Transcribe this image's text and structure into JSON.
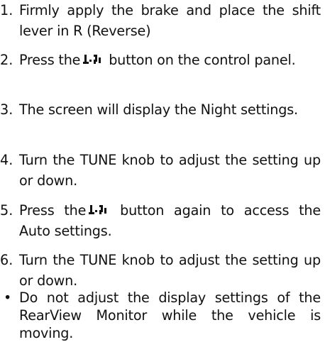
{
  "steps": [
    {
      "num": "1.",
      "text": "Firmly apply the brake and place the shift lever in R (Reverse)"
    },
    {
      "num": "2.",
      "before": "Press the",
      "icon": "camera-display-icon",
      "after": " button on the control panel."
    },
    {
      "num": "3.",
      "text": "The screen will display the Night settings."
    },
    {
      "num": "4.",
      "text": "Turn the TUNE knob to adjust the setting up or down."
    },
    {
      "num": "5.",
      "before": "Press the",
      "icon": "camera-display-icon",
      "after": " button again to access the Auto settings."
    },
    {
      "num": "6.",
      "text": "Turn the TUNE knob to adjust the setting up or down."
    }
  ],
  "bullet": {
    "symbol": "•",
    "text": "Do not adjust the display settings of the RearView Monitor while the vehicle is moving."
  }
}
